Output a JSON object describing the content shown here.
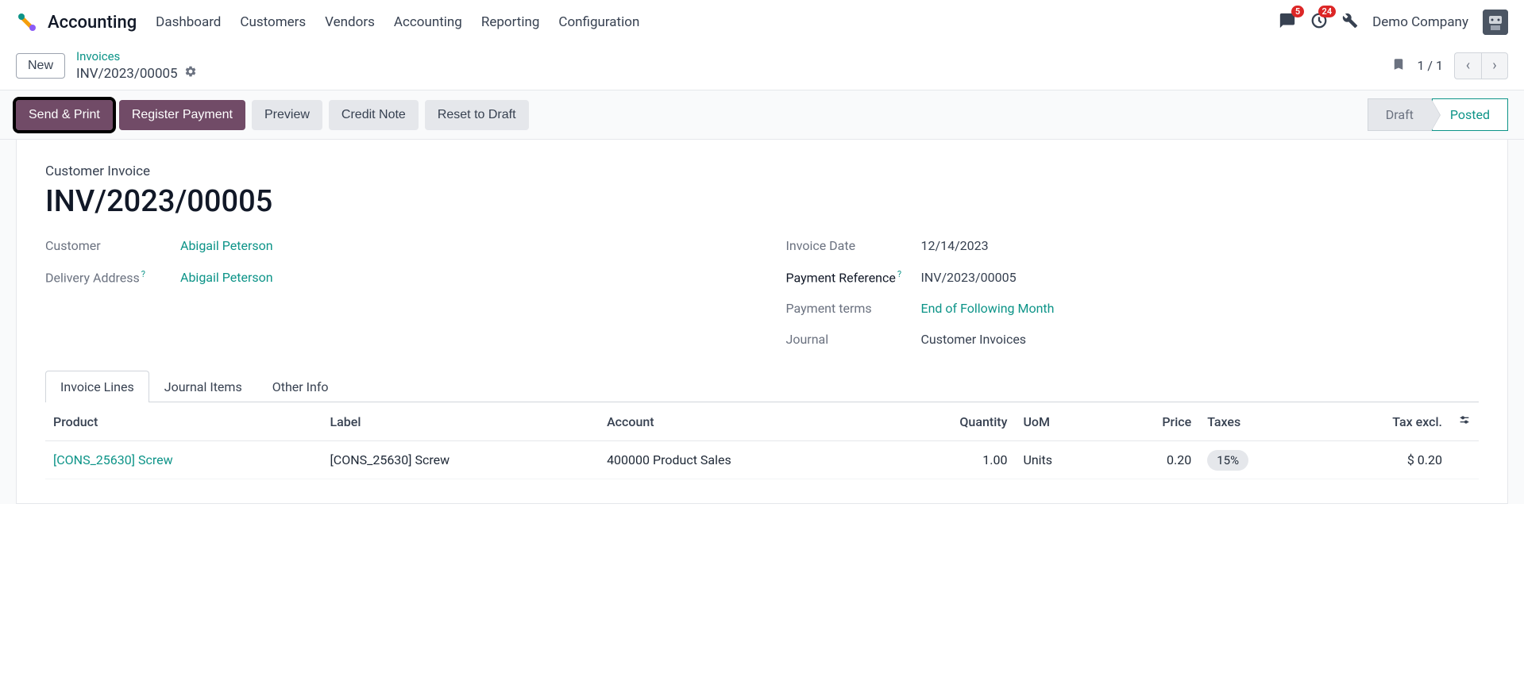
{
  "nav": {
    "app_name": "Accounting",
    "links": [
      "Dashboard",
      "Customers",
      "Vendors",
      "Accounting",
      "Reporting",
      "Configuration"
    ],
    "badges": {
      "messages": "5",
      "activities": "24"
    },
    "company": "Demo Company"
  },
  "breadcrumb": {
    "new_label": "New",
    "parent": "Invoices",
    "current": "INV/2023/00005",
    "pager": "1 / 1"
  },
  "actions": {
    "send_print": "Send & Print",
    "register_payment": "Register Payment",
    "preview": "Preview",
    "credit_note": "Credit Note",
    "reset_draft": "Reset to Draft"
  },
  "status": {
    "draft": "Draft",
    "posted": "Posted"
  },
  "doc": {
    "type": "Customer Invoice",
    "name": "INV/2023/00005",
    "customer_label": "Customer",
    "customer": "Abigail Peterson",
    "delivery_label": "Delivery Address",
    "delivery": "Abigail Peterson",
    "invoice_date_label": "Invoice Date",
    "invoice_date": "12/14/2023",
    "payment_ref_label": "Payment Reference",
    "payment_ref": "INV/2023/00005",
    "payment_terms_label": "Payment terms",
    "payment_terms": "End of Following Month",
    "journal_label": "Journal",
    "journal": "Customer Invoices"
  },
  "tabs": {
    "invoice_lines": "Invoice Lines",
    "journal_items": "Journal Items",
    "other_info": "Other Info"
  },
  "table": {
    "headers": {
      "product": "Product",
      "label": "Label",
      "account": "Account",
      "quantity": "Quantity",
      "uom": "UoM",
      "price": "Price",
      "taxes": "Taxes",
      "tax_excl": "Tax excl."
    },
    "rows": [
      {
        "product": "[CONS_25630] Screw",
        "label": "[CONS_25630] Screw",
        "account": "400000 Product Sales",
        "quantity": "1.00",
        "uom": "Units",
        "price": "0.20",
        "taxes": "15%",
        "tax_excl": "$ 0.20"
      }
    ]
  }
}
